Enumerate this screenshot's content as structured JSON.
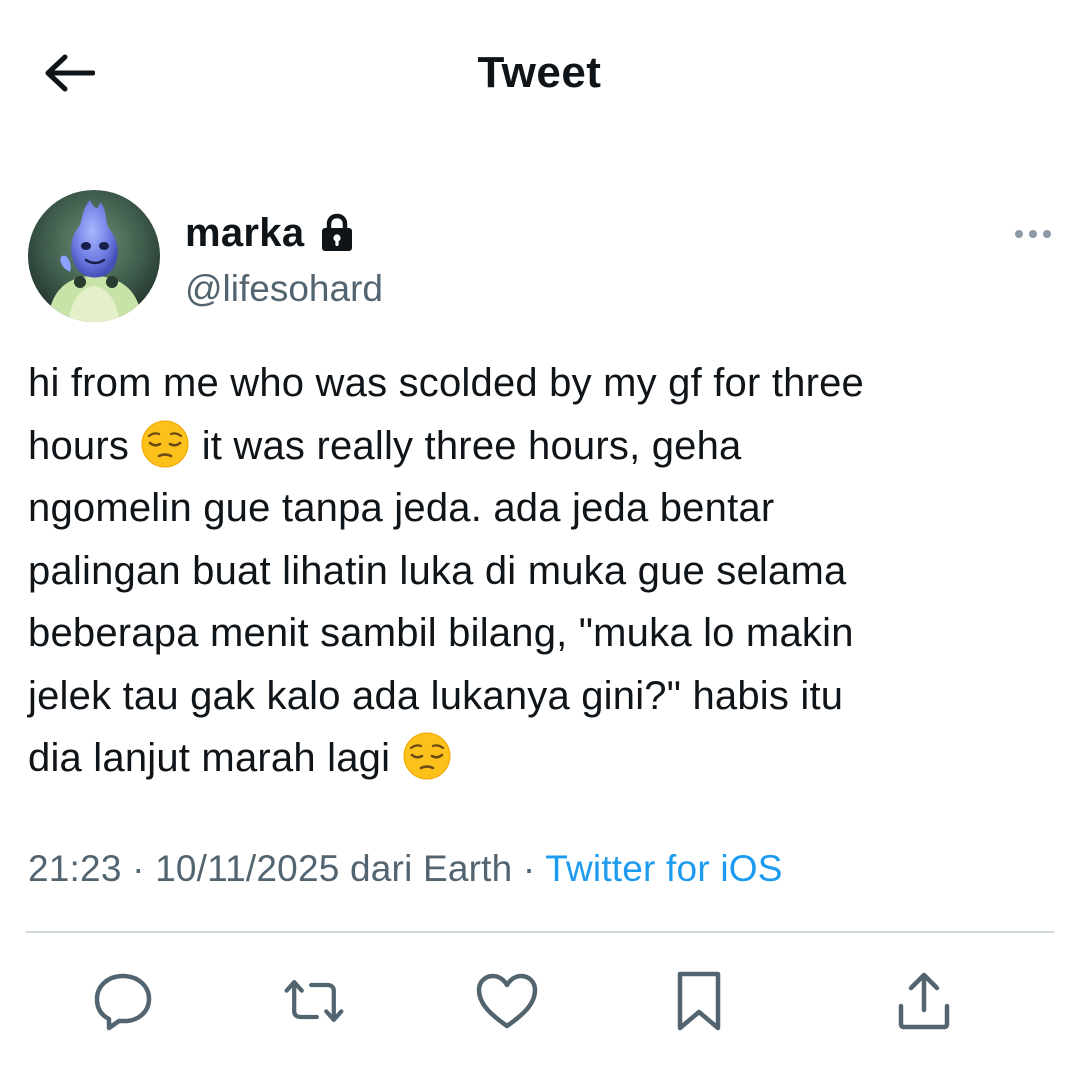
{
  "header": {
    "title": "Tweet",
    "back_icon": "arrow-left-icon"
  },
  "author": {
    "display_name": "marka",
    "handle": "@lifesohard",
    "protected_icon": "lock-icon",
    "more_icon": "more-horizontal-icon"
  },
  "tweet": {
    "lines": [
      [
        "hi from me who was scolded by my gf for three"
      ],
      [
        "hours ",
        "😔",
        " it was really three hours, geha"
      ],
      [
        "ngomelin gue tanpa jeda. ada jeda bentar"
      ],
      [
        "palingan buat lihatin luka di muka gue selama"
      ],
      [
        "beberapa menit sambil bilang, \"muka lo makin"
      ],
      [
        "jelek tau gak kalo ada lukanya gini?\" habis itu"
      ],
      [
        "dia lanjut marah lagi ",
        "😔"
      ]
    ]
  },
  "meta": {
    "time": "21:23",
    "separator": " · ",
    "date_location": "10/11/2025 dari Earth",
    "source": "Twitter for iOS"
  },
  "actions": [
    {
      "name": "reply-button",
      "icon": "reply-icon"
    },
    {
      "name": "retweet-button",
      "icon": "retweet-icon"
    },
    {
      "name": "like-button",
      "icon": "heart-icon"
    },
    {
      "name": "bookmark-button",
      "icon": "bookmark-icon"
    },
    {
      "name": "share-button",
      "icon": "share-icon"
    }
  ],
  "colors": {
    "text": "#0f1419",
    "secondary": "#536471",
    "link": "#1d9bf0",
    "divider": "#cfd9de"
  }
}
